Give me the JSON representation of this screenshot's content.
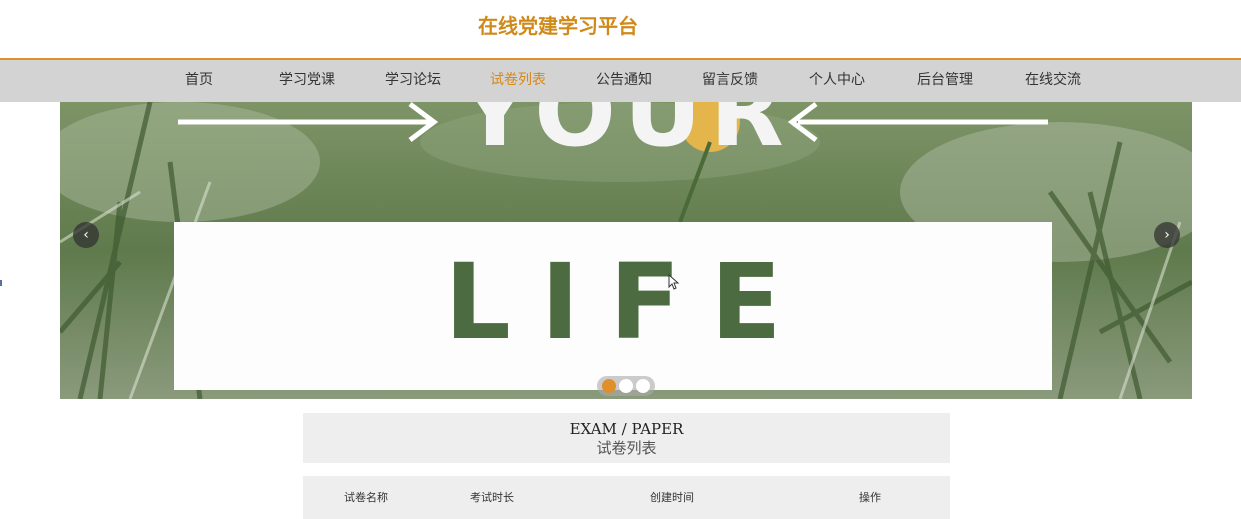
{
  "header": {
    "title": "在线党建学习平台"
  },
  "nav": {
    "items": [
      {
        "label": "首页"
      },
      {
        "label": "学习党课"
      },
      {
        "label": "学习论坛"
      },
      {
        "label": "试卷列表",
        "active": true
      },
      {
        "label": "公告通知"
      },
      {
        "label": "留言反馈"
      },
      {
        "label": "个人中心"
      },
      {
        "label": "后台管理"
      },
      {
        "label": "在线交流"
      }
    ]
  },
  "banner": {
    "word_top": "YOUR",
    "word_main": "LIFE",
    "prev_icon": "chevron-left-icon",
    "next_icon": "chevron-right-icon",
    "slide_count": 3,
    "active_slide": 1
  },
  "section": {
    "title_en": "EXAM / PAPER",
    "title_cn": "试卷列表"
  },
  "table": {
    "columns": [
      "试卷名称",
      "考试时长",
      "创建时间",
      "操作"
    ]
  },
  "colors": {
    "accent": "#e0902a",
    "title": "#cf8a1a",
    "nav_bg": "#d3d3d3",
    "panel_bg": "#eeeeee"
  }
}
